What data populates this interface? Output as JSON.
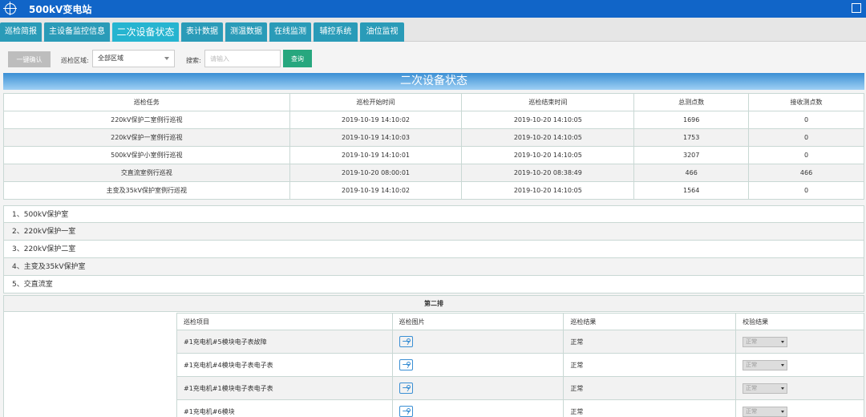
{
  "app": {
    "title": "500kV变电站"
  },
  "nav": {
    "tabs": [
      {
        "label": "巡检简报"
      },
      {
        "label": "主设备监控信息"
      },
      {
        "label": "二次设备状态"
      },
      {
        "label": "表计数据"
      },
      {
        "label": "测温数据"
      },
      {
        "label": "在线监测"
      },
      {
        "label": "辅控系统"
      },
      {
        "label": "油位监视"
      }
    ]
  },
  "toolbar": {
    "confirm_label": "一键确认",
    "area_label": "巡检区域:",
    "area_value": "全部区域",
    "search_label": "搜索:",
    "search_placeholder": "请输入",
    "query_label": "查询"
  },
  "section": {
    "title": "二次设备状态"
  },
  "task_table": {
    "headers": [
      "巡检任务",
      "巡检开始时间",
      "巡检结束时间",
      "总测点数",
      "接收测点数"
    ],
    "rows": [
      [
        "220kV保护二室例行巡视",
        "2019-10-19 14:10:02",
        "2019-10-20 14:10:05",
        "1696",
        "0"
      ],
      [
        "220kV保护一室例行巡视",
        "2019-10-19 14:10:03",
        "2019-10-20 14:10:05",
        "1753",
        "0"
      ],
      [
        "500kV保护小室例行巡视",
        "2019-10-19 14:10:01",
        "2019-10-20 14:10:05",
        "3207",
        "0"
      ],
      [
        "交直流室例行巡视",
        "2019-10-20 08:00:01",
        "2019-10-20 08:38:49",
        "466",
        "466"
      ],
      [
        "主变及35kV保护室例行巡视",
        "2019-10-19 14:10:02",
        "2019-10-20 14:10:05",
        "1564",
        "0"
      ]
    ]
  },
  "rooms": [
    {
      "label": "1、500kV保护室"
    },
    {
      "label": "2、220kV保护一室"
    },
    {
      "label": "3、220kV保护二室"
    },
    {
      "label": "4、主变及35kV保护室"
    },
    {
      "label": "5、交直流室"
    }
  ],
  "panel": {
    "title": "第二排"
  },
  "detail_table": {
    "headers": [
      "巡检项目",
      "巡检图片",
      "巡检结果",
      "校验结果"
    ],
    "rows": [
      {
        "item": "#1充电机#5模块电子表故障",
        "result": "正常",
        "check": "正常"
      },
      {
        "item": "#1充电机#4模块电子表电子表",
        "result": "正常",
        "check": "正常"
      },
      {
        "item": "#1充电机#1模块电子表电子表",
        "result": "正常",
        "check": "正常"
      },
      {
        "item": "#1充电机#6模块",
        "result": "正常",
        "check": "正常"
      }
    ]
  },
  "icons": {
    "photo": "image-icon",
    "logo": "crosshair-icon",
    "exit": "exit-icon"
  },
  "colors": {
    "titlebar": "#1165c8",
    "tab": "#2a9bb8",
    "tab_active": "#26b4d0",
    "query": "#27a77e"
  }
}
